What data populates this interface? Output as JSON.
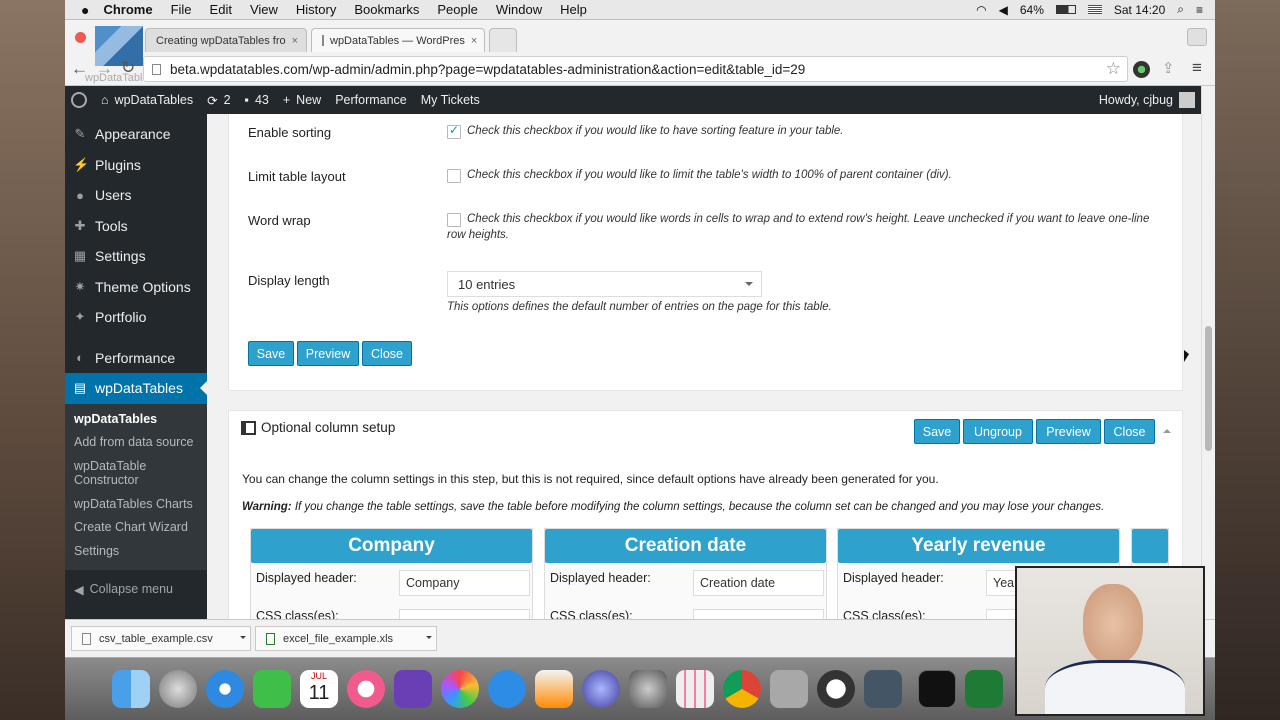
{
  "menubar": {
    "app": "Chrome",
    "items": [
      "File",
      "Edit",
      "View",
      "History",
      "Bookmarks",
      "People",
      "Window",
      "Help"
    ],
    "battery": "64%",
    "clock": "Sat 14:20"
  },
  "browser": {
    "tabs": [
      {
        "label": "Creating wpDataTables fro"
      },
      {
        "label": "wpDataTables — WordPres"
      }
    ],
    "url": "beta.wpdatatables.com/wp-admin/admin.php?page=wpdatatables-administration&action=edit&table_id=29",
    "ghost": "wpDataTables"
  },
  "adminbar": {
    "site": "wpDataTables",
    "updates": "2",
    "comments": "43",
    "new": "New",
    "performance": "Performance",
    "tickets": "My Tickets",
    "howdy": "Howdy, cjbug"
  },
  "sidebar": {
    "items": [
      {
        "label": "Appearance",
        "icon": "brush-icon"
      },
      {
        "label": "Plugins",
        "icon": "plug-icon"
      },
      {
        "label": "Users",
        "icon": "user-icon"
      },
      {
        "label": "Tools",
        "icon": "wrench-icon"
      },
      {
        "label": "Settings",
        "icon": "settings-icon"
      },
      {
        "label": "Theme Options",
        "icon": "gear-icon"
      },
      {
        "label": "Portfolio",
        "icon": "pin-icon"
      }
    ],
    "performance": "Performance",
    "active": "wpDataTables",
    "sub": [
      "wpDataTables",
      "Add from data source",
      "wpDataTable Constructor",
      "wpDataTables Charts",
      "Create Chart Wizard",
      "Settings"
    ],
    "collapse": "Collapse menu"
  },
  "table_settings": {
    "sorting_label": "Enable sorting",
    "sorting_desc": "Check this checkbox if you would like to have sorting feature in your table.",
    "sorting_checked": true,
    "limit_label": "Limit table layout",
    "limit_desc": "Check this checkbox if you would like to limit the table's width to 100% of parent container (div).",
    "wrap_label": "Word wrap",
    "wrap_desc": "Check this checkbox if you would like words in cells to wrap and to extend row's height. Leave unchecked if you want to leave one-line row heights.",
    "length_label": "Display length",
    "length_value": "10 entries",
    "length_desc": "This options defines the default number of entries on the page for this table.",
    "save": "Save",
    "preview": "Preview",
    "close": "Close"
  },
  "columns": {
    "title": "Optional column setup",
    "save": "Save",
    "ungroup": "Ungroup",
    "preview": "Preview",
    "close": "Close",
    "intro": "You can change the column settings in this step, but this is not required, since default options have already been generated for you.",
    "warning_label": "Warning:",
    "warning_text": "If you change the table settings, save the table before modifying the column settings, because the column set can be changed and you may lose your changes.",
    "header_label": "Displayed header:",
    "css_label": "CSS class(es):",
    "cards": [
      {
        "name": "Company",
        "value": "Company"
      },
      {
        "name": "Creation date",
        "value": "Creation date"
      },
      {
        "name": "Yearly revenue",
        "value": "Year"
      }
    ]
  },
  "downloads": [
    {
      "name": "csv_table_example.csv"
    },
    {
      "name": "excel_file_example.xls"
    }
  ],
  "dock": {
    "calendar_month": "JUL",
    "calendar_day": "11"
  }
}
